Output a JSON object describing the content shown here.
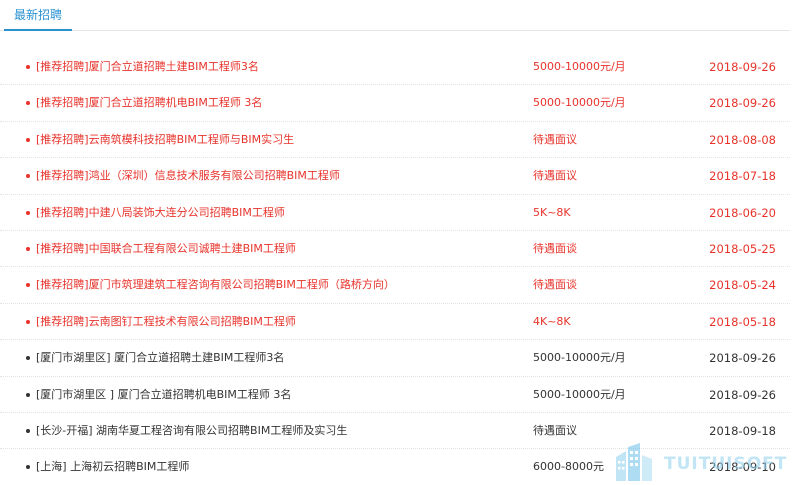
{
  "tabs": [
    {
      "label": "最新招聘"
    }
  ],
  "jobs": [
    {
      "title": "[推荐招聘]厦门合立道招聘土建BIM工程师3名",
      "salary": "5000-10000元/月",
      "date": "2018-09-26",
      "featured": true
    },
    {
      "title": "[推荐招聘]厦门合立道招聘机电BIM工程师 3名",
      "salary": "5000-10000元/月",
      "date": "2018-09-26",
      "featured": true
    },
    {
      "title": "[推荐招聘]云南筑模科技招聘BIM工程师与BIM实习生",
      "salary": "待遇面议",
      "date": "2018-08-08",
      "featured": true
    },
    {
      "title": "[推荐招聘]鸿业（深圳）信息技术服务有限公司招聘BIM工程师",
      "salary": "待遇面议",
      "date": "2018-07-18",
      "featured": true
    },
    {
      "title": "[推荐招聘]中建八局装饰大连分公司招聘BIM工程师",
      "salary": "5K~8K",
      "date": "2018-06-20",
      "featured": true
    },
    {
      "title": "[推荐招聘]中国联合工程有限公司诚聘土建BIM工程师",
      "salary": "待遇面谈",
      "date": "2018-05-25",
      "featured": true
    },
    {
      "title": "[推荐招聘]厦门市筑理建筑工程咨询有限公司招聘BIM工程师（路桥方向）",
      "salary": "待遇面谈",
      "date": "2018-05-24",
      "featured": true
    },
    {
      "title": "[推荐招聘]云南图钉工程技术有限公司招聘BIM工程师",
      "salary": "4K~8K",
      "date": "2018-05-18",
      "featured": true
    },
    {
      "title": "[厦门市湖里区] 厦门合立道招聘土建BIM工程师3名",
      "salary": "5000-10000元/月",
      "date": "2018-09-26",
      "featured": false
    },
    {
      "title": "[厦门市湖里区 ] 厦门合立道招聘机电BIM工程师 3名",
      "salary": "5000-10000元/月",
      "date": "2018-09-26",
      "featured": false
    },
    {
      "title": "[长沙-开福] 湖南华夏工程咨询有限公司招聘BIM工程师及实习生",
      "salary": "待遇面议",
      "date": "2018-09-18",
      "featured": false
    },
    {
      "title": "[上海] 上海初云招聘BIM工程师",
      "salary": "6000-8000元",
      "date": "2018-09-10",
      "featured": false
    }
  ],
  "watermark": {
    "text": "TUITUISOFT"
  },
  "colors": {
    "accent": "#2a92d2",
    "featured": "#e8332b",
    "normal": "#333333"
  }
}
